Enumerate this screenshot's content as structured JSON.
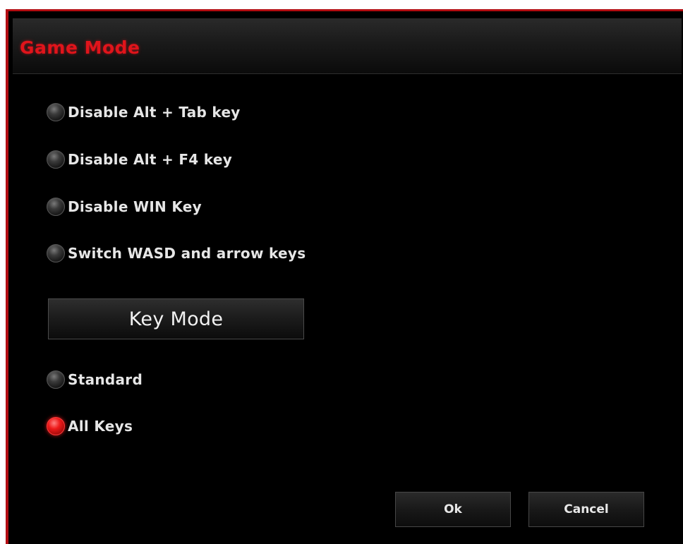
{
  "window": {
    "title": "Game Mode",
    "accent_color": "#e0141b"
  },
  "options": [
    {
      "label": "Disable Alt + Tab key",
      "selected": false
    },
    {
      "label": "Disable Alt + F4 key",
      "selected": false
    },
    {
      "label": "Disable WIN Key",
      "selected": false
    },
    {
      "label": "Switch WASD and arrow keys",
      "selected": false
    }
  ],
  "key_mode": {
    "header": "Key Mode",
    "options": [
      {
        "label": "Standard",
        "selected": false
      },
      {
        "label": "All Keys",
        "selected": true
      }
    ]
  },
  "buttons": {
    "ok_label": "Ok",
    "cancel_label": "Cancel"
  }
}
